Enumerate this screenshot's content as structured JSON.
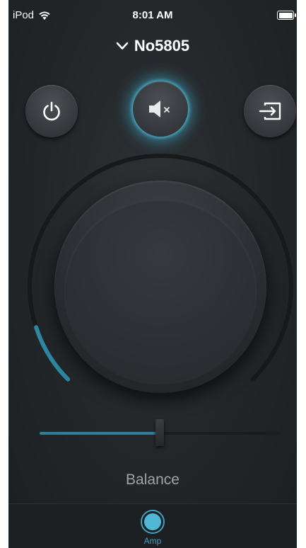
{
  "status_bar": {
    "carrier": "iPod",
    "time": "8:01 AM",
    "wifi_icon": "wifi-icon",
    "battery_icon": "battery-full-icon"
  },
  "device_selector": {
    "name": "No5805",
    "icon": "chevron-down-icon"
  },
  "controls": {
    "power": {
      "icon": "power-icon"
    },
    "mute": {
      "icon": "speaker-mute-icon",
      "active": true
    },
    "input": {
      "icon": "input-select-icon"
    }
  },
  "volume_dial": {
    "level": 0.1
  },
  "balance": {
    "label": "Balance",
    "value": 0.5
  },
  "tab_bar": {
    "tabs": [
      {
        "label": "Amp",
        "icon": "amp-icon",
        "active": true
      }
    ]
  },
  "colors": {
    "accent": "#3f9fbd",
    "glow": "#40aac8",
    "background": "#222629",
    "text": "#ffffff",
    "muted_text": "#9ea3a7"
  }
}
